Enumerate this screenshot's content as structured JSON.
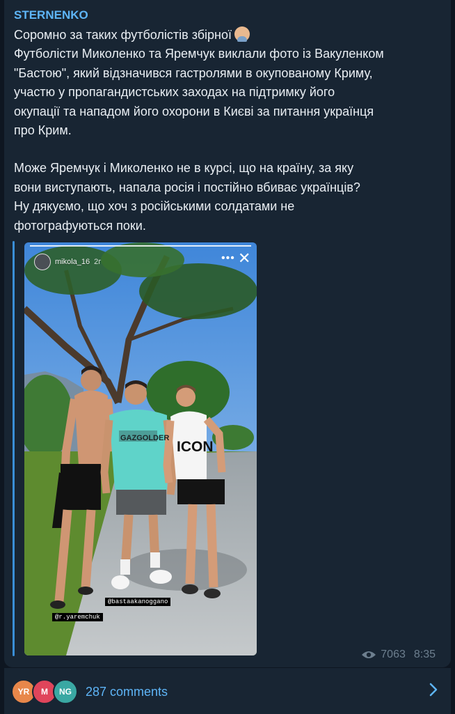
{
  "post": {
    "channel_name": "STERNENKO",
    "text_lines": [
      "Соромно за таких футболістів збірної",
      "Футболісти Миколенко та Яремчук виклали фото із Вакуленком",
      "\"Бастою\", який відзначився гастролями в окупованому Криму,",
      "участю у пропагандистських заходах на підтримку його",
      "окупації та нападом його охорони в Києві за питання українця",
      "про Крим.",
      "Може Яремчук і Миколенко  не в курсі, що на країну, за яку",
      "вони виступають, напала росія і постійно вбиває українців?",
      "Ну дякуємо, що хоч з російськими солдатами не",
      "фотографуються поки."
    ],
    "emoji_icon": "man-facepalming-emoji"
  },
  "story": {
    "username": "mikola_16",
    "time_ago": "2г",
    "more_icon": "more-dots-icon",
    "close_icon": "close-icon",
    "tags": {
      "tag_basta": "@bastaakanoggano",
      "tag_yaremchuk": "@r.yaremchuk"
    },
    "shirt_text_1": "GAZGOLDER",
    "shirt_text_2": "ICON"
  },
  "meta": {
    "views": "7063",
    "time": "8:35"
  },
  "footer": {
    "avatars": [
      {
        "initials": "YR",
        "color": "#e8874a"
      },
      {
        "initials": "M",
        "color": "#e0455b"
      },
      {
        "initials": "NG",
        "color": "#3aa8a3"
      }
    ],
    "comments_label": "287 comments"
  },
  "colors": {
    "background": "#0e1621",
    "bubble": "#182533",
    "accent": "#5eb5f7",
    "text": "#e9eef3",
    "meta": "#6d7f8f"
  }
}
